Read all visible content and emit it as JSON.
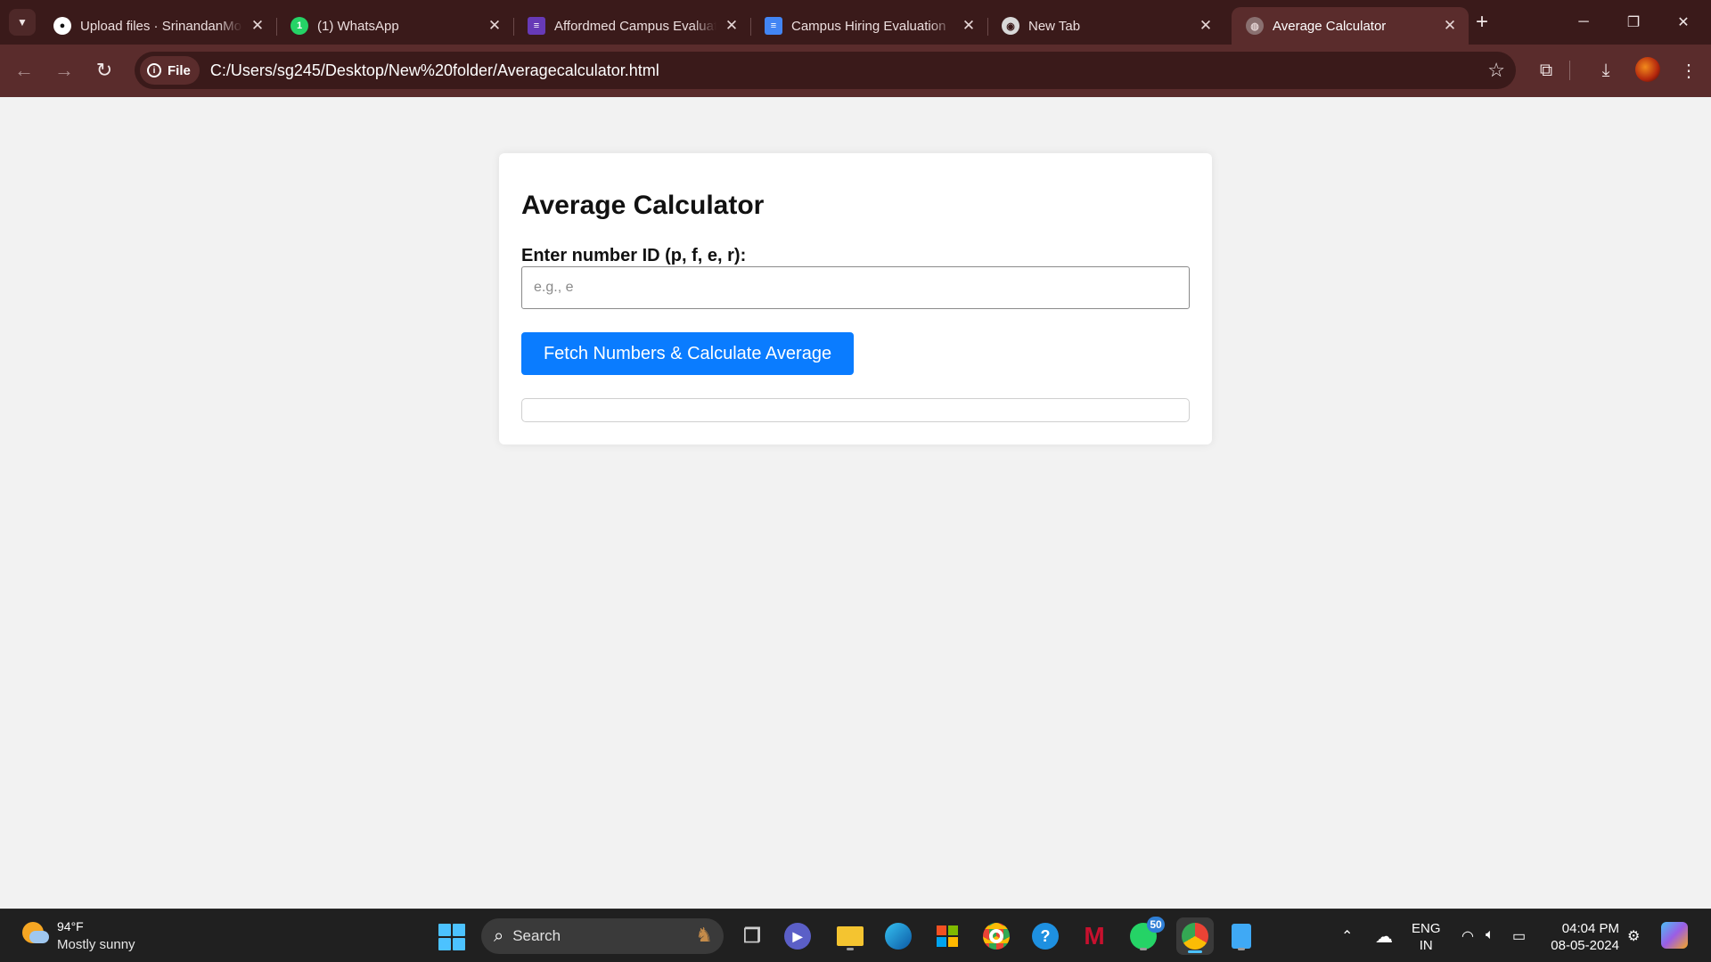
{
  "browser": {
    "tabs": [
      {
        "title": "Upload files · SrinandanMo",
        "icon": "github-icon",
        "active": false
      },
      {
        "title": "(1) WhatsApp",
        "icon": "whatsapp-icon",
        "active": false
      },
      {
        "title": "Affordmed Campus Evaluat",
        "icon": "forms-icon",
        "active": false
      },
      {
        "title": "Campus Hiring Evaluation",
        "icon": "docs-icon",
        "active": false
      },
      {
        "title": "New Tab",
        "icon": "chrome-icon",
        "active": false
      },
      {
        "title": "Average Calculator",
        "icon": "globe-icon",
        "active": true
      }
    ],
    "address": {
      "chip_label": "File",
      "url": "C:/Users/sg245/Desktop/New%20folder/Averagecalculator.html"
    }
  },
  "page": {
    "title": "Average Calculator",
    "input_label": "Enter number ID (p, f, e, r):",
    "input_value": "",
    "input_placeholder": "e.g., e",
    "button_label": "Fetch Numbers & Calculate Average",
    "result": ""
  },
  "taskbar": {
    "weather_temp": "94°F",
    "weather_condition": "Mostly sunny",
    "search_label": "Search",
    "whatsapp_badge": "50",
    "language_line1": "ENG",
    "language_line2": "IN",
    "time": "04:04 PM",
    "date": "08-05-2024"
  },
  "colors": {
    "tab_strip": "#3a1a1a",
    "toolbar": "#5a2c2c",
    "page_bg": "#f2f2f2",
    "button": "#0a7cff",
    "taskbar": "#202020"
  }
}
